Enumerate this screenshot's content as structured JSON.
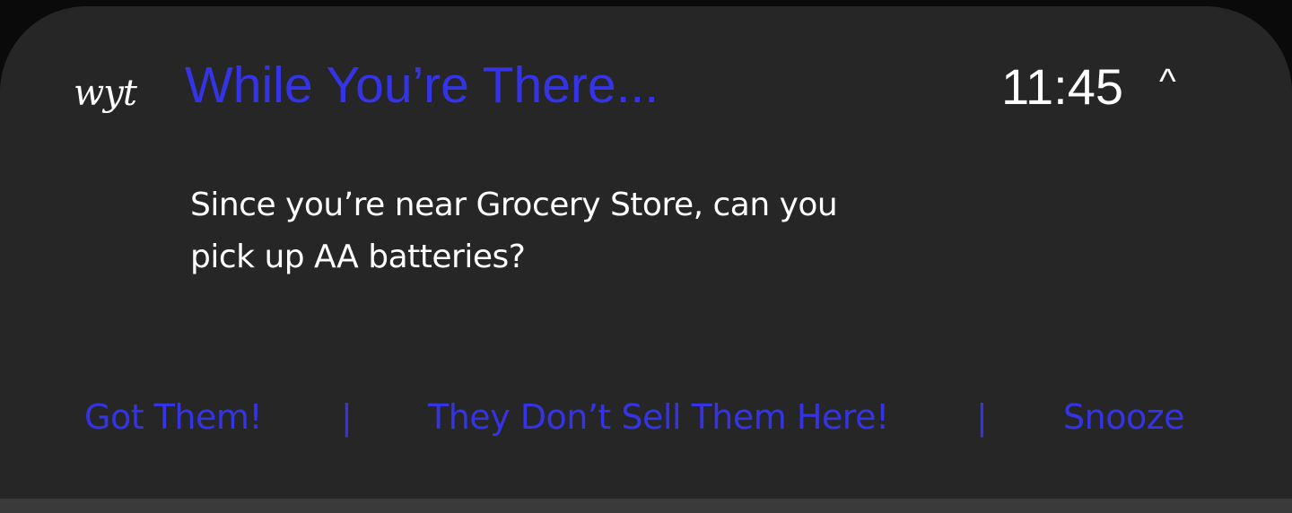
{
  "notification": {
    "app_logo": "wyt",
    "app_title": "While You’re There...",
    "time": "11:45",
    "collapse_glyph": "^",
    "message_line1": "Since you’re near Grocery Store, can you",
    "message_line2": "pick up AA batteries?",
    "actions": {
      "got_them": "Got Them!",
      "separator": "|",
      "not_sold": "They Don’t Sell Them Here!",
      "snooze": "Snooze"
    }
  },
  "colors": {
    "accent": "#3434e6",
    "card_background": "#262626",
    "text": "#ffffff",
    "outer_background": "#0a0a0a"
  },
  "icons": {
    "collapse": "caret-up-icon"
  }
}
